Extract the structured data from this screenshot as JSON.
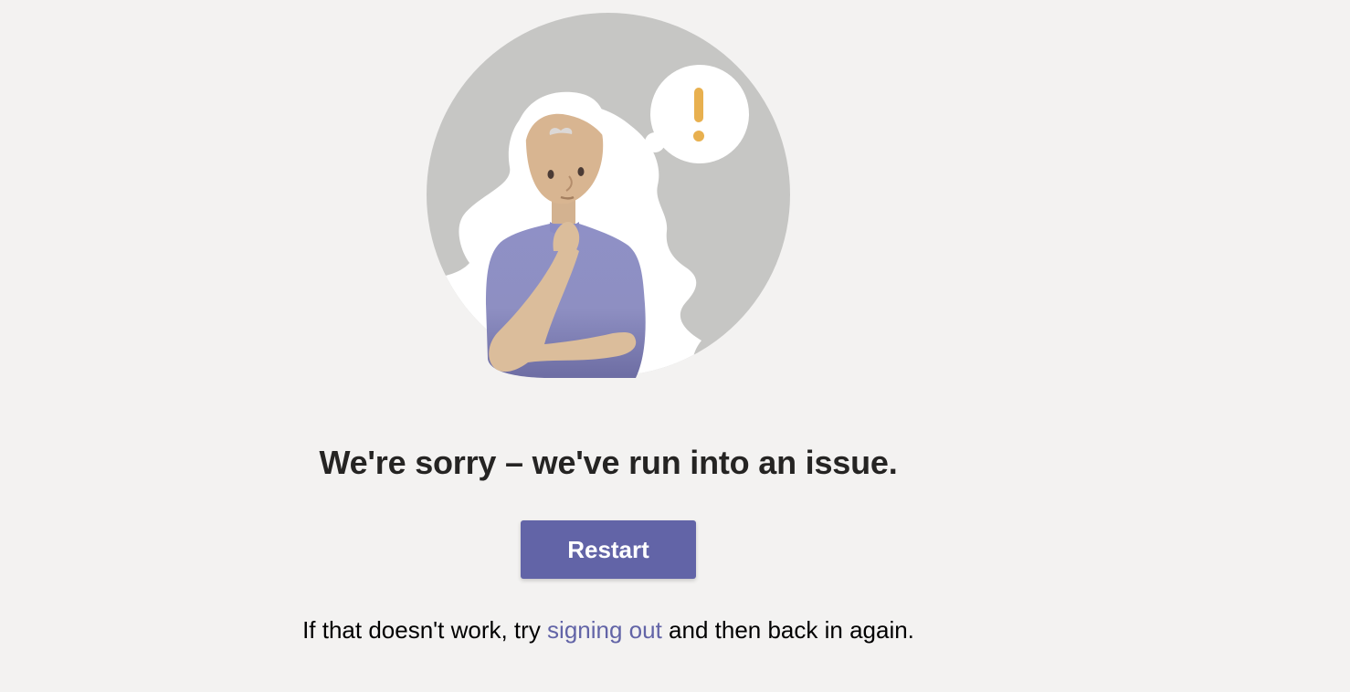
{
  "error": {
    "headline": "We're sorry – we've run into an issue.",
    "restart_label": "Restart",
    "help_prefix": "If that doesn't work, try ",
    "help_link": "signing out",
    "help_suffix": " and then back in again."
  },
  "illustration": {
    "icon": "thinking-person-with-alert-icon",
    "alert_glyph": "exclamation-mark-icon"
  },
  "colors": {
    "background": "#f3f2f1",
    "accent": "#6264a7",
    "alert": "#e8b04f",
    "circle": "#c8c7c5"
  }
}
